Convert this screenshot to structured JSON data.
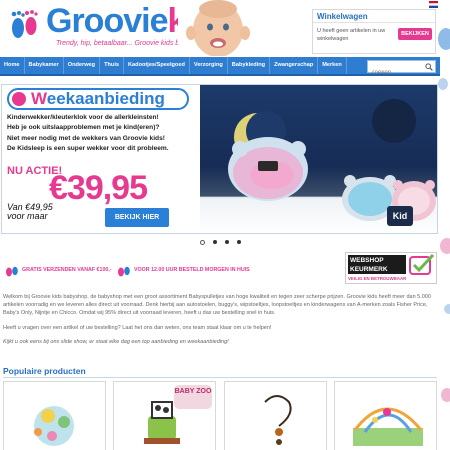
{
  "header": {
    "logo_groovie": "Groovie",
    "logo_kids": "kids",
    "tagline": "Trendy, hip, betaalbaar... Groovie kids babyshop!",
    "cart_title": "Winkelwagen",
    "cart_text": "U heeft geen artikelen in uw winkelwagen",
    "cart_button": "BEKIJKEN"
  },
  "nav": {
    "items": [
      "Home",
      "Babykamer",
      "Onderweg",
      "Thuis",
      "Kadootjes/Speelgoed",
      "Verzorging",
      "Babykleding",
      "Zwangerschap",
      "Merken"
    ],
    "search_placeholder": "Zoeken"
  },
  "banner": {
    "week_w": "W",
    "week_rest": "eekaanbieding",
    "lines": [
      "Kinderwekker/kleuterklok voor de allerkleinsten!",
      "Heb je ook uitslaapproblemen met je kind(eren)?",
      "Niet meer nodig met de wekkers van Groovie kids!",
      "De Kidsleep is een super wekker voor dit probleem."
    ],
    "nu_actie": "NU ACTIE!",
    "price": "€39,95",
    "old_price_1": "Van €49,95",
    "old_price_2": "voor maar",
    "button": "BEKIJK HIER",
    "product_logo": "Kid"
  },
  "carousel": {
    "count": 4,
    "active": 1
  },
  "perks": {
    "shipping": "GRATIS VERZENDEN VANAF €100,-",
    "delivery": "VOOR 12.00 UUR BESTELD MORGEN IN HUIS",
    "keurmerk_1": "WEBSHOP",
    "keurmerk_2": "KEURMERK",
    "keurmerk_sub": "VEILIG EN BETROUWBAAR"
  },
  "intro": {
    "p1": "Welkom bij Groovie kids babyshop, de babyshop met een groot assortiment Babyspulletjes van hoge kwaliteit en tegen zeer scherpe prijzen. Groovie kids heeft meer dan 5.000 artikelen voorradig en we leveren alles direct uit voorraad. Denk hierbij aan autostoelen, buggy's, wipstoeltjes, loopstoeltjes en kinderwagens van A-merken zoals Fisher Price, Baby's Only, Nijntje en Chicco. Omdat wij 95% direct uit voorraad leveren, heeft u das uw bestelling snel in huis.",
    "p2": "Heeft u vragen over een artikel of uw bestelling? Laat het ons dan weten, ons team staat klaar om u te helpen!",
    "p3": "Kijkt u ook eens bij ons slide show, er staat elke dag een top aanbieding en weekaanbieding!"
  },
  "popular": {
    "title": "Populaire producten",
    "badge": "BABY ZOO"
  },
  "colors": {
    "brand_blue": "#2a7fd6",
    "brand_pink": "#e6398f"
  }
}
